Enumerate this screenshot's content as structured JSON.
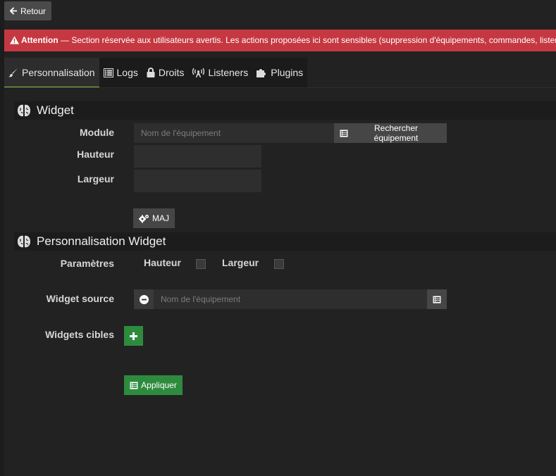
{
  "back_button": {
    "label": "Retour"
  },
  "alert": {
    "title": "Attention",
    "message": " — Section réservée aux utilisateurs avertis. Les actions proposées ici sont sensibles (suppression d'équipements, commandes, listeners…)"
  },
  "tabs": [
    {
      "label": "Personnalisation",
      "icon": "brush-icon",
      "active": true
    },
    {
      "label": "Logs",
      "icon": "list-icon",
      "active": false
    },
    {
      "label": "Droits",
      "icon": "lock-icon",
      "active": false
    },
    {
      "label": "Listeners",
      "icon": "antenna-icon",
      "active": false
    },
    {
      "label": "Plugins",
      "icon": "puzzle-icon",
      "active": false
    }
  ],
  "widget_section": {
    "title": "Widget",
    "module_label": "Module",
    "module_placeholder": "Nom de l'équipement",
    "search_button": "Rechercher équipement",
    "height_label": "Hauteur",
    "width_label": "Largeur",
    "update_button": "MAJ"
  },
  "custom_section": {
    "title": "Personnalisation Widget",
    "params_label": "Paramètres",
    "height_label": "Hauteur",
    "width_label": "Largeur",
    "source_label": "Widget source",
    "source_placeholder": "Nom de l'équipement",
    "targets_label": "Widgets cibles",
    "apply_button": "Appliquer"
  },
  "colors": {
    "alert": "#c63841",
    "success": "#2e8b3e",
    "active_tab_border": "#8ac249"
  }
}
